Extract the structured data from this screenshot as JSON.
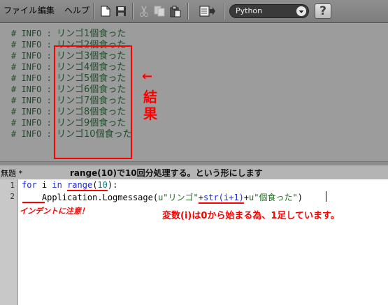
{
  "menu": {
    "file": "ファイル",
    "edit": "編集",
    "help": "ヘルプ"
  },
  "toolbar": {
    "icons": [
      "new-file-icon",
      "save-icon",
      "cut-icon",
      "copy-icon",
      "paste-icon",
      "run-icon"
    ],
    "language": "Python",
    "help_glyph": "?"
  },
  "output": {
    "lines": [
      {
        "prefix": "# INFO : ",
        "text": "リンゴ1個食った"
      },
      {
        "prefix": "# INFO : ",
        "text": "リンゴ2個食った"
      },
      {
        "prefix": "# INFO : ",
        "text": "リンゴ3個食った"
      },
      {
        "prefix": "# INFO : ",
        "text": "リンゴ4個食った"
      },
      {
        "prefix": "# INFO : ",
        "text": "リンゴ5個食った"
      },
      {
        "prefix": "# INFO : ",
        "text": "リンゴ6個食った"
      },
      {
        "prefix": "# INFO : ",
        "text": "リンゴ7個食った"
      },
      {
        "prefix": "# INFO : ",
        "text": "リンゴ8個食った"
      },
      {
        "prefix": "# INFO : ",
        "text": "リンゴ9個食った"
      },
      {
        "prefix": "# INFO : ",
        "text": "リンゴ10個食った"
      }
    ],
    "arrow": "←",
    "result_chars": [
      "結",
      "果"
    ]
  },
  "document": {
    "title": "無題 *",
    "note": "range(10)で10回分処理する。という形にします"
  },
  "editor": {
    "line_numbers": [
      "1",
      "2"
    ],
    "line1": {
      "kw1": "for",
      "sp1": " i ",
      "kw2": "in",
      "sp2": " ",
      "fn": "range",
      "open": "(",
      "num": "10",
      "close": "):"
    },
    "line2": {
      "indent": "    ",
      "call": "Application.Logmessage(",
      "str1": "u\"リンゴ\"",
      "plus1": "+",
      "strcall": "str(i+1)",
      "plus2": "+",
      "str2": "u\"個食った\"",
      "end": ")"
    },
    "indent_note": "インデントに注意！",
    "plus_note": "変数(i)は0から始まる為、1足しています。"
  },
  "colors": {
    "annotation": "#ff0000",
    "output_text": "#1f4d2b",
    "keyword": "#1a2bd6"
  }
}
